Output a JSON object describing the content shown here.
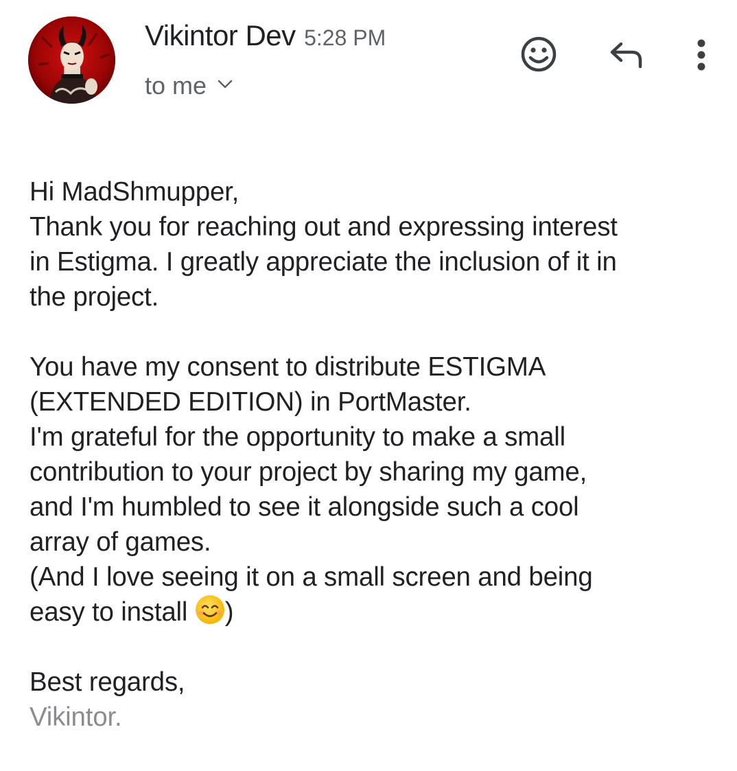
{
  "header": {
    "sender_name": "Vikintor Dev",
    "time": "5:28 PM",
    "recipient_label": "to me",
    "avatar_icon": "avatar-demon-portrait",
    "icons": {
      "emoji": "smiley-face-icon",
      "reply": "reply-arrow-icon",
      "more": "more-vert-icon",
      "expand": "chevron-down-icon"
    }
  },
  "message": {
    "greeting": "Hi MadShmupper,",
    "paragraph1": [
      "Thank you for reaching out and expressing interest",
      "in Estigma. I greatly appreciate the inclusion of it in",
      "the project."
    ],
    "paragraph2": [
      "You have my consent to distribute ESTIGMA",
      "(EXTENDED EDITION) in PortMaster.",
      "I'm grateful for the opportunity to make a small",
      "contribution to your project by sharing my game,",
      "and I'm humbled to see it alongside such a cool",
      "array of games.",
      "(And I love seeing it on a small screen and being",
      "easy to install"
    ],
    "closing_paren": ")",
    "sign_off": "Best regards,",
    "signature": "Vikintor."
  },
  "colors": {
    "text": "#202124",
    "secondary": "#5f6368",
    "signature": "#8a8c90",
    "avatar_bg": "#8b0000"
  }
}
